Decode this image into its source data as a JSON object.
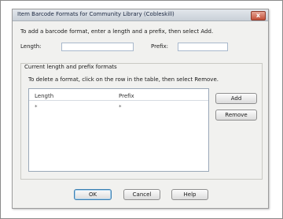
{
  "window": {
    "title": "Item Barcode Formats for Community Library (Cobleskill)",
    "close_glyph": "x"
  },
  "instructions": {
    "add": "To add a barcode format, enter a length and a prefix, then select Add.",
    "delete": "To delete a format, click on the row in the table, then select Remove."
  },
  "fields": {
    "length_label": "Length:",
    "length_value": "",
    "prefix_label": "Prefix:",
    "prefix_value": ""
  },
  "group": {
    "title": "Current length and prefix formats"
  },
  "table": {
    "columns": [
      "Length",
      "Prefix"
    ],
    "rows": [
      [
        "*",
        "*"
      ]
    ]
  },
  "buttons": {
    "add": "Add",
    "remove": "Remove",
    "ok": "OK",
    "cancel": "Cancel",
    "help": "Help"
  }
}
